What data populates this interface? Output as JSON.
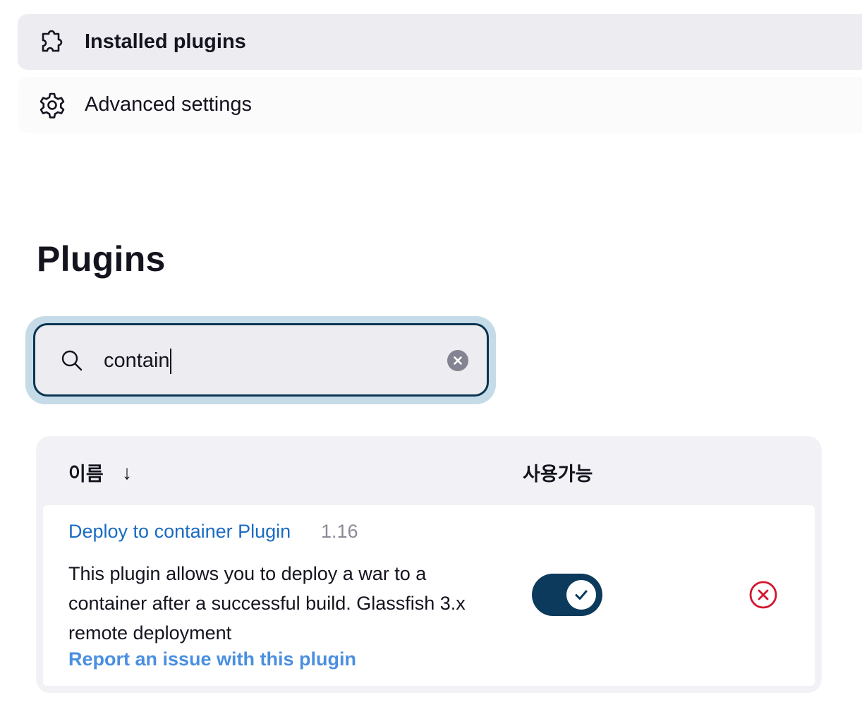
{
  "nav": {
    "items": [
      {
        "label": "Installed plugins",
        "icon": "puzzle-icon",
        "active": true
      },
      {
        "label": "Advanced settings",
        "icon": "gear-icon",
        "active": false
      }
    ]
  },
  "page": {
    "title": "Plugins"
  },
  "search": {
    "value": "contain",
    "icon": "search-icon",
    "clear_icon": "clear-icon"
  },
  "table": {
    "columns": {
      "name": "이름",
      "sort_indicator": "↓",
      "enabled": "사용가능"
    },
    "rows": [
      {
        "name": "Deploy to container Plugin",
        "version": "1.16",
        "description": "This plugin allows you to deploy a war to a container after a successful build. Glassfish 3.x remote deployment",
        "report_link": "Report an issue with this plugin",
        "enabled": true
      }
    ]
  },
  "colors": {
    "accent": "#0b3a5c",
    "link": "#1a6bc2",
    "danger": "#d4142e"
  }
}
